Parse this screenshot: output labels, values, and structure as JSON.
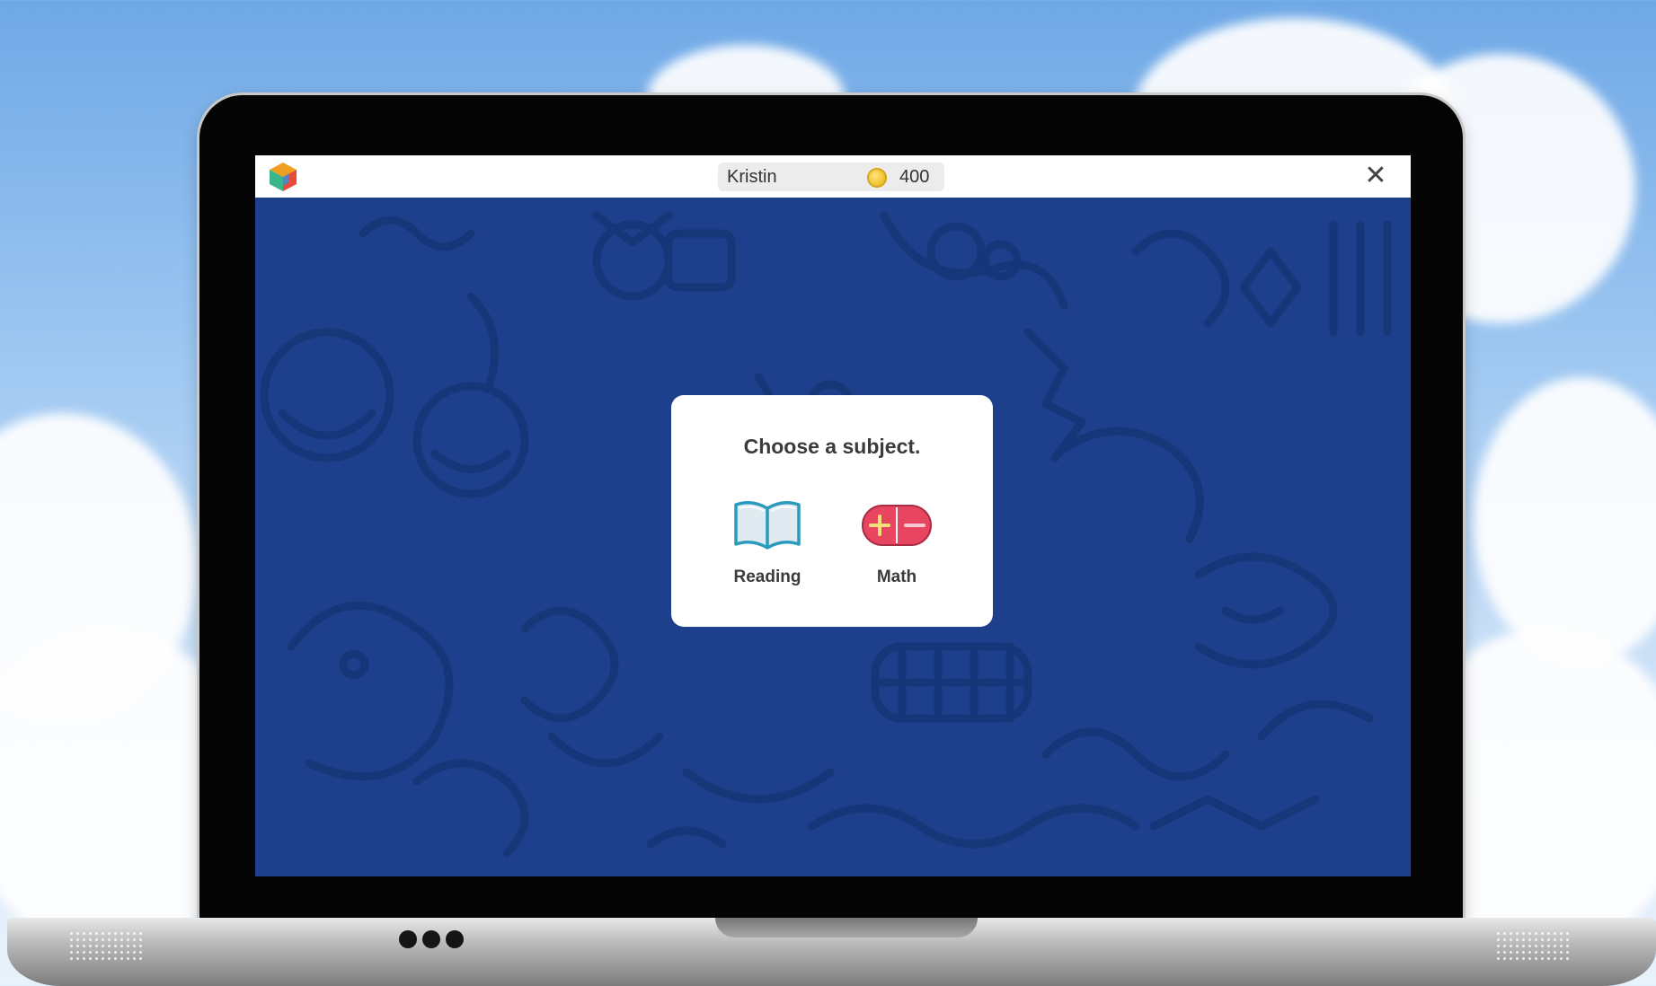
{
  "topbar": {
    "user_name": "Kristin",
    "coins": "400",
    "close_label": "✕"
  },
  "dialog": {
    "title": "Choose a subject.",
    "subjects": [
      {
        "label": "Reading",
        "icon": "book-icon"
      },
      {
        "label": "Math",
        "icon": "plus-minus-icon"
      }
    ]
  },
  "colors": {
    "screen_background": "#1d3f8c",
    "math_icon": "#e84560",
    "reading_icon": "#2a9bbd",
    "coin": "#f1c232"
  }
}
